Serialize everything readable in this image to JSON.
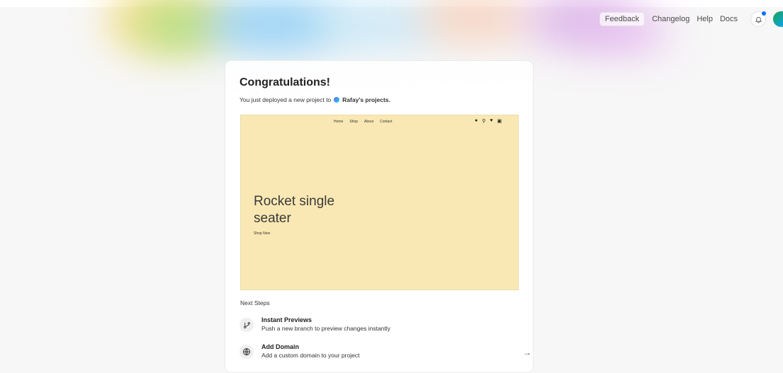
{
  "topnav": {
    "feedback": "Feedback",
    "changelog": "Changelog",
    "help": "Help",
    "docs": "Docs"
  },
  "card": {
    "title": "Congratulations!",
    "subtitle_prefix": "You just deployed a new project to",
    "team_name": "Rafay's projects."
  },
  "preview": {
    "nav": [
      "Home",
      "Shop",
      "About",
      "Contact"
    ],
    "icons": [
      "user-icon",
      "search-icon",
      "heart-icon",
      "cart-icon"
    ],
    "hero_line1": "Rocket single",
    "hero_line2": "seater",
    "cta": "Shop Now",
    "background": "#f9e8b3"
  },
  "next_steps": {
    "heading": "Next Steps",
    "items": [
      {
        "icon": "git-branch-icon",
        "title": "Instant Previews",
        "desc": "Push a new branch to preview changes instantly"
      },
      {
        "icon": "globe-icon",
        "title": "Add Domain",
        "desc": "Add a custom domain to your project"
      }
    ]
  },
  "colors": {
    "notification_dot": "#0070f3",
    "avatar": "#16a34a"
  }
}
